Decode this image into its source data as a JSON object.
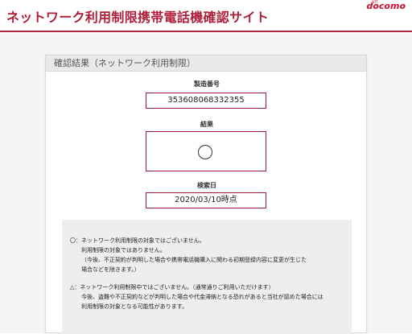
{
  "header": {
    "title": "ネットワーク利用制限携帯電話機確認サイト",
    "logo_small": "NTT",
    "logo": "docomo"
  },
  "panel": {
    "heading": "確認結果（ネットワーク利用制限）",
    "imei_label": "製造番号",
    "imei_value": "353608068332355",
    "result_label": "結果",
    "result_symbol": "circle-icon",
    "date_label": "検索日",
    "date_value": "2020/03/10時点"
  },
  "legend": {
    "lines": [
      "〇：ネットワーク利用制限の対象ではございません。",
      "利用制限の対象ではありません。",
      "（今後、不正契約が判明した場合や携帯電話機購入に関わる初期登録内容に変更が生じた",
      "場合などを除きます。）",
      "△：ネットワーク利用制限中ではございません。（通常通りご利用いただけます）",
      "今後、盗難や不正契約などが判明した場合や代金滞納となる恐れがあると当社が認めた場合には",
      "利用制限の対象となる可能性があります。"
    ]
  },
  "colors": {
    "brand": "#b01f3a",
    "box_border": "#9b1b34"
  }
}
